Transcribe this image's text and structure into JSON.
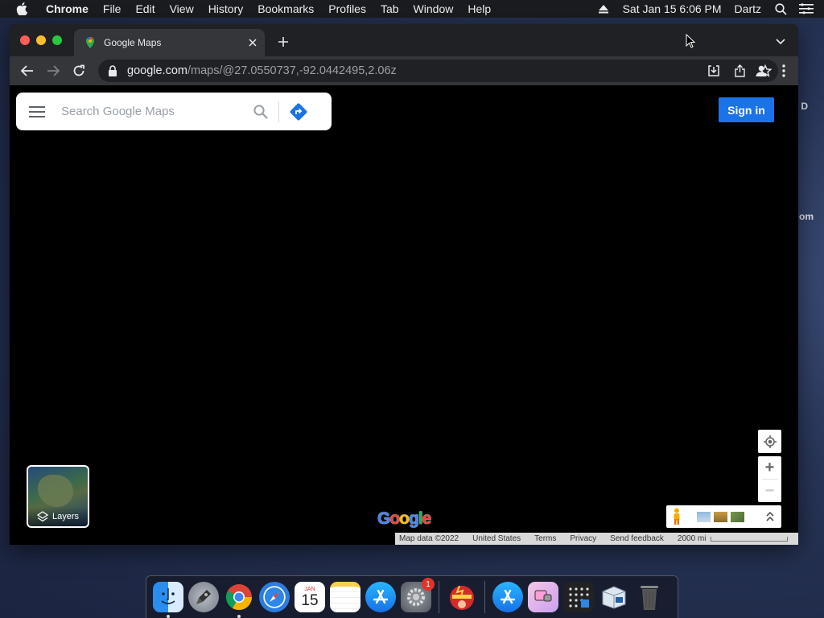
{
  "menubar": {
    "app_name": "Chrome",
    "menus": [
      "File",
      "Edit",
      "View",
      "History",
      "Bookmarks",
      "Profiles",
      "Tab",
      "Window",
      "Help"
    ],
    "datetime": "Sat Jan 15  6:06 PM",
    "user": "Dartz"
  },
  "behind_window": {
    "text_1": "D",
    "text_2": "om"
  },
  "browser": {
    "tab_title": "Google Maps",
    "url_host": "google.com",
    "url_path": "/maps/@27.0550737,-92.0442495,2.06z"
  },
  "maps": {
    "search_placeholder": "Search Google Maps",
    "sign_in": "Sign in",
    "layers_label": "Layers",
    "logo": "Google",
    "footer": {
      "map_data": "Map data ©2022",
      "region": "United States",
      "terms": "Terms",
      "privacy": "Privacy",
      "feedback": "Send feedback",
      "scale": "2000 mi"
    }
  },
  "dock": {
    "apps": [
      "Finder",
      "Launchpad",
      "Google Chrome",
      "Safari",
      "Calendar",
      "Notes",
      "App Store",
      "System Preferences",
      "Flash",
      "App Store",
      "Nyan",
      "Grid",
      "VirtualBox",
      "Trash"
    ],
    "calendar_month": "JAN",
    "calendar_day": "15",
    "sysprefs_badge": "1"
  },
  "colors": {
    "accent": "#1a73e8",
    "tab_bg": "#35363a",
    "strip_bg": "#202124"
  }
}
